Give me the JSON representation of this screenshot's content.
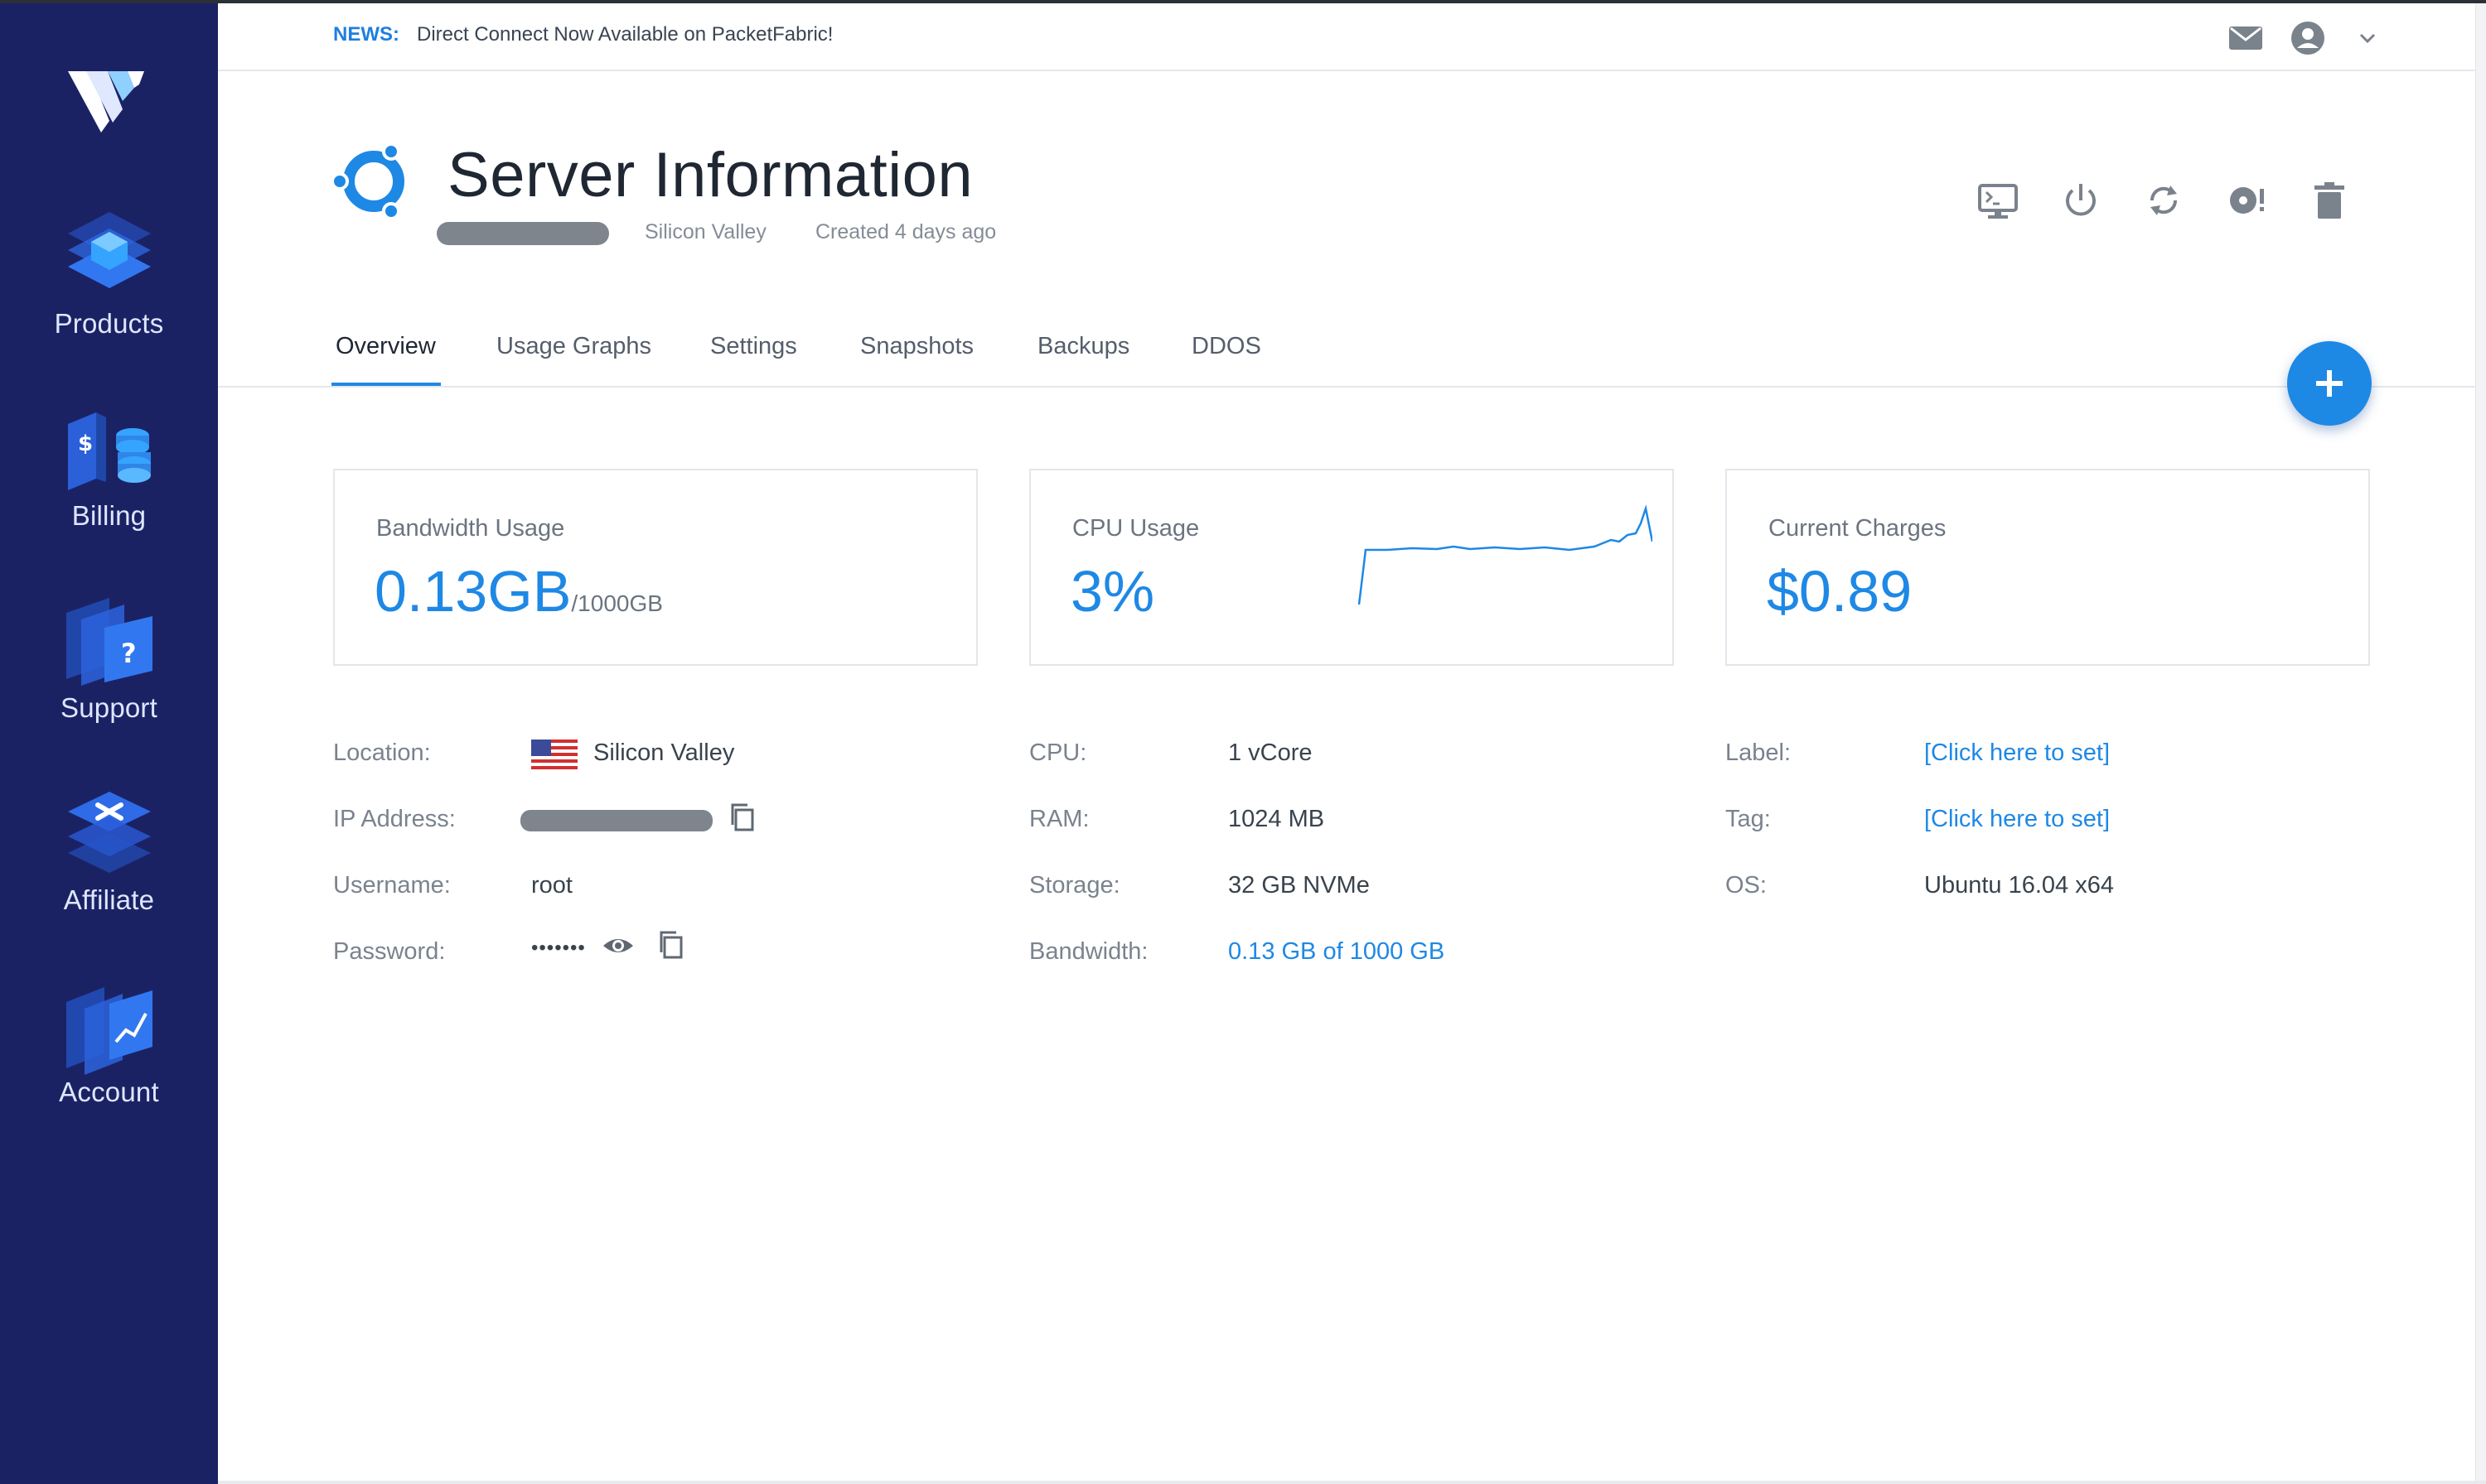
{
  "sidebar": {
    "items": [
      {
        "label": "Products",
        "icon": "products-icon"
      },
      {
        "label": "Billing",
        "icon": "billing-icon"
      },
      {
        "label": "Support",
        "icon": "support-icon"
      },
      {
        "label": "Affiliate",
        "icon": "affiliate-icon"
      },
      {
        "label": "Account",
        "icon": "account-icon"
      }
    ]
  },
  "news": {
    "label": "NEWS:",
    "text": "Direct Connect Now Available on PacketFabric!"
  },
  "header_icons": [
    "mail-icon",
    "user-avatar-icon",
    "chevron-down-icon"
  ],
  "server": {
    "title": "Server Information",
    "location": "Silicon Valley",
    "created": "Created 4 days ago",
    "os_icon": "ubuntu-icon"
  },
  "actions": [
    "console-icon",
    "power-icon",
    "restart-icon",
    "reinstall-icon",
    "trash-icon"
  ],
  "tabs": [
    {
      "label": "Overview",
      "active": true
    },
    {
      "label": "Usage Graphs",
      "active": false
    },
    {
      "label": "Settings",
      "active": false
    },
    {
      "label": "Snapshots",
      "active": false
    },
    {
      "label": "Backups",
      "active": false
    },
    {
      "label": "DDOS",
      "active": false
    }
  ],
  "cards": {
    "bandwidth": {
      "title": "Bandwidth Usage",
      "value": "0.13GB",
      "unit": "/1000GB"
    },
    "cpu": {
      "title": "CPU Usage",
      "value": "3%"
    },
    "charges": {
      "title": "Current Charges",
      "value": "$0.89"
    }
  },
  "details": {
    "location": {
      "label": "Location:",
      "value": "Silicon Valley"
    },
    "ip": {
      "label": "IP Address:"
    },
    "username": {
      "label": "Username:",
      "value": "root"
    },
    "password": {
      "label": "Password:",
      "value": "•••••••"
    },
    "cpu": {
      "label": "CPU:",
      "value": "1 vCore"
    },
    "ram": {
      "label": "RAM:",
      "value": "1024 MB"
    },
    "storage": {
      "label": "Storage:",
      "value": "32 GB NVMe"
    },
    "bandwidth": {
      "label": "Bandwidth:",
      "value": "0.13 GB of 1000 GB"
    },
    "server_label": {
      "label": "Label:",
      "value": "[Click here to set]"
    },
    "tag": {
      "label": "Tag:",
      "value": "[Click here to set]"
    },
    "os": {
      "label": "OS:",
      "value": "Ubuntu 16.04 x64"
    }
  },
  "colors": {
    "sidebar_bg": "#1b2264",
    "accent": "#1e88e5",
    "text": "#39434d"
  }
}
